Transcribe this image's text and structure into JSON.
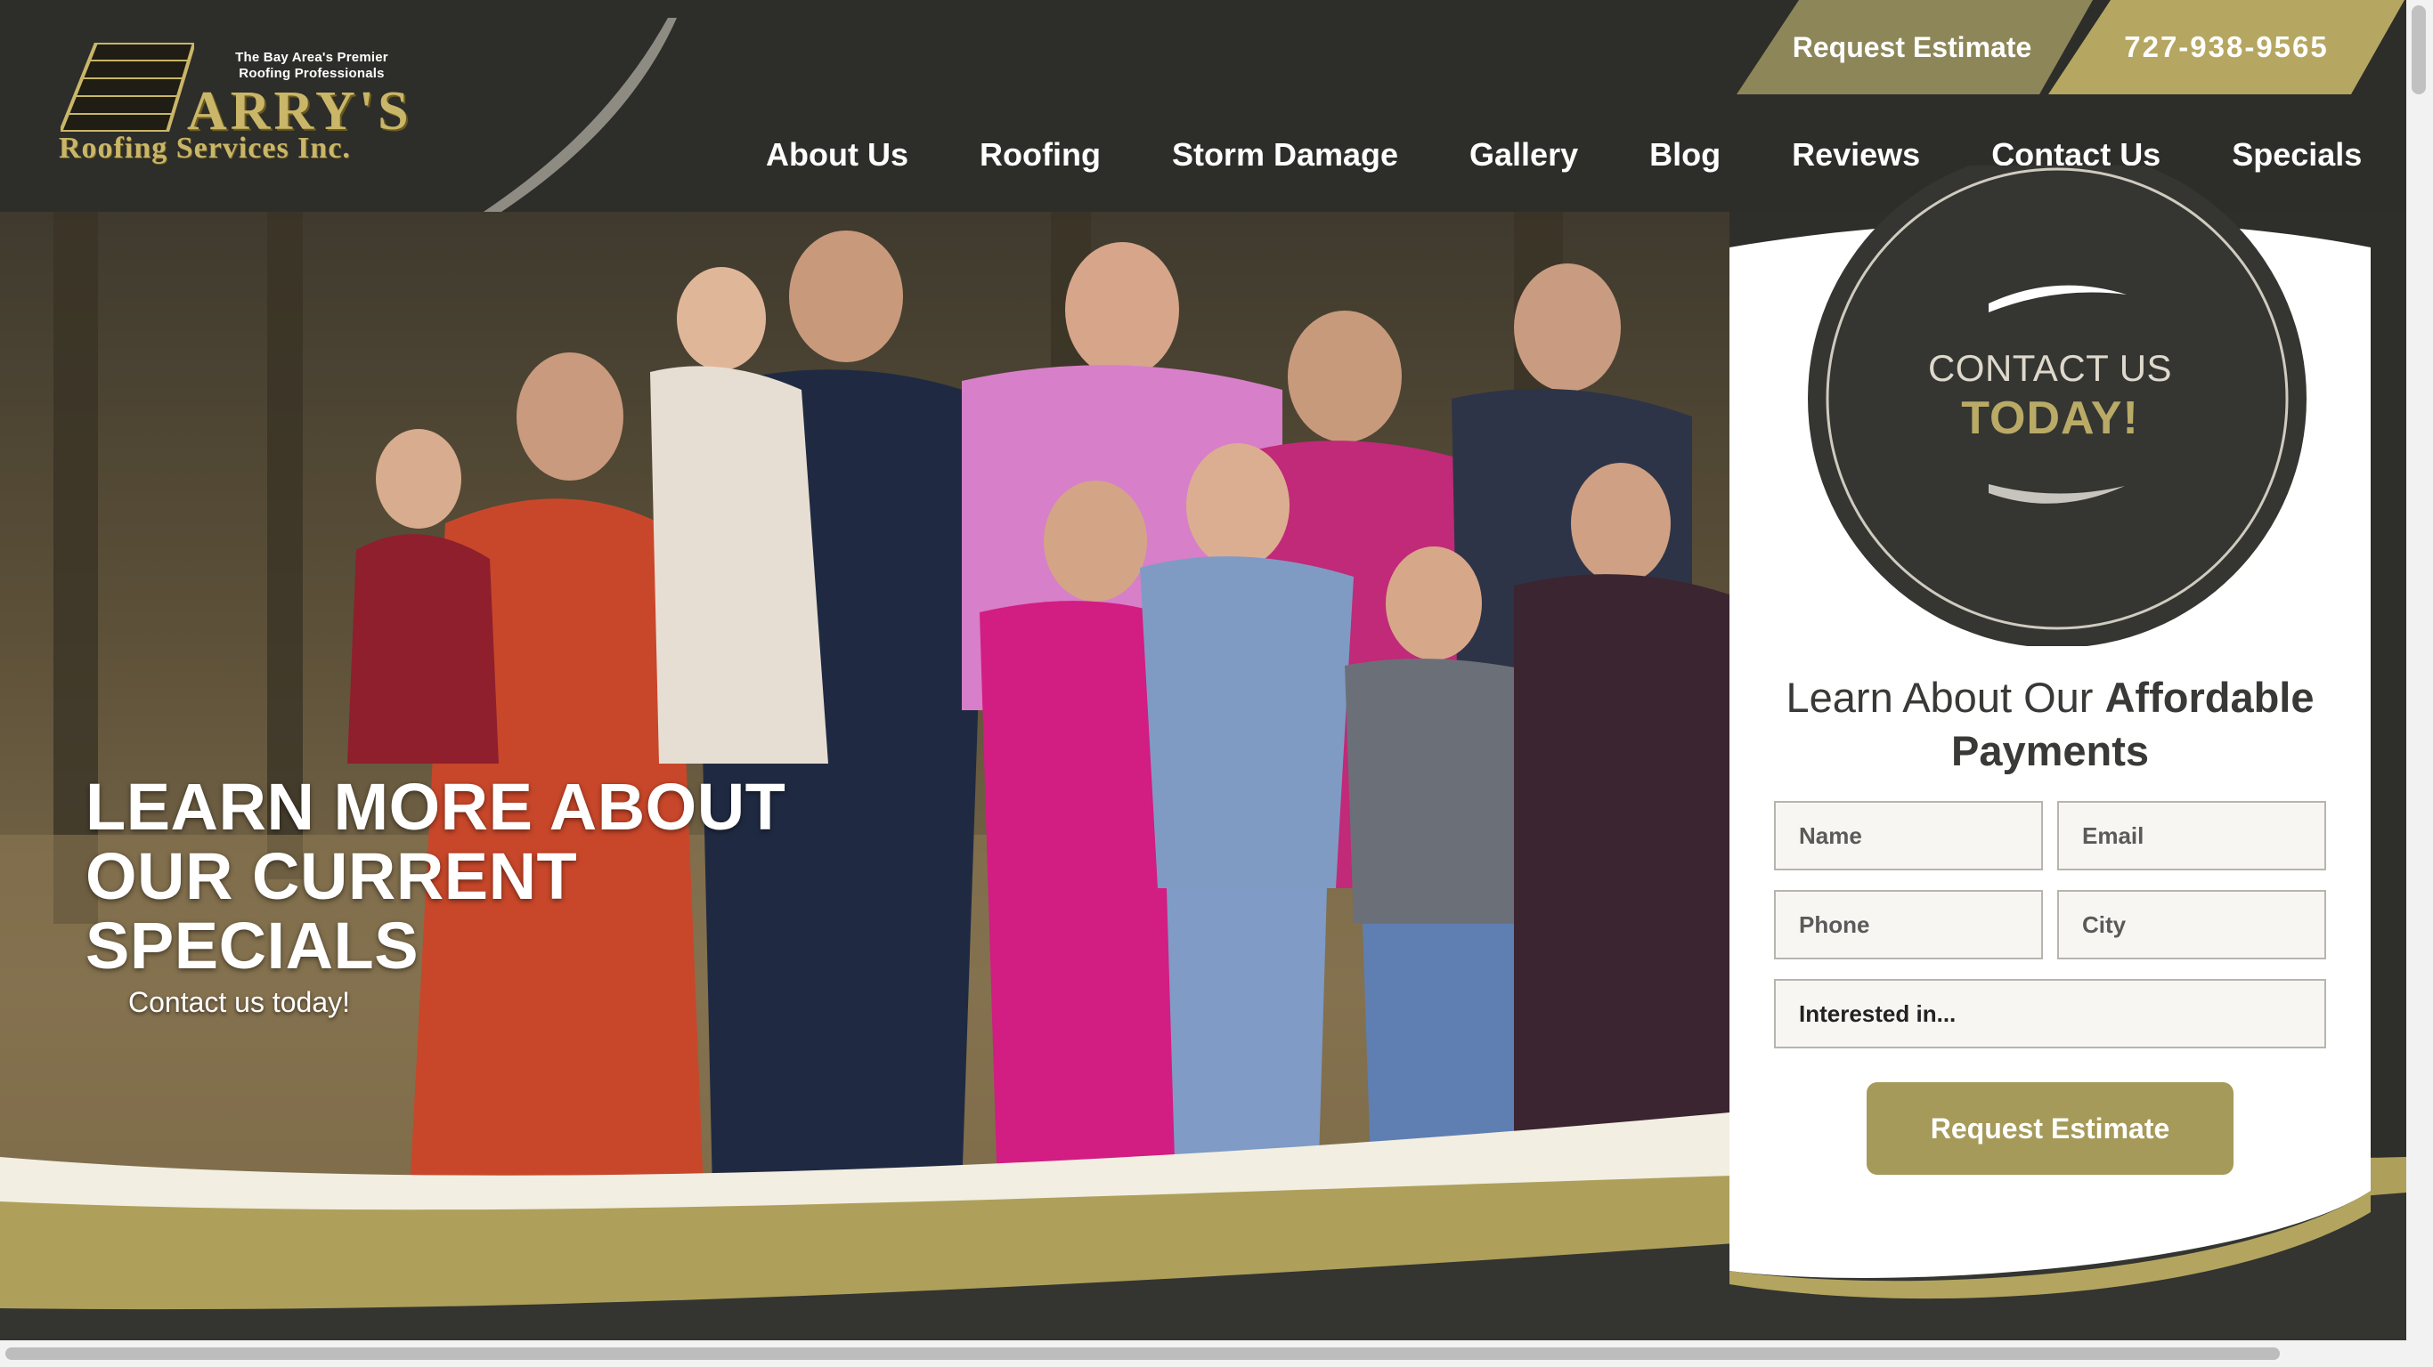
{
  "brand": {
    "tagline_line1": "The Bay Area's Premier",
    "tagline_line2": "Roofing Professionals",
    "logo_word": "ARRY'S",
    "logo_sub": "Roofing Services Inc.",
    "colors": {
      "gold": "#b5a661",
      "dark": "#2d2d2a",
      "olive": "#8d8658"
    }
  },
  "header": {
    "estimate_label": "Request Estimate",
    "phone": "727-938-9565",
    "nav": [
      "About Us",
      "Roofing",
      "Storm Damage",
      "Gallery",
      "Blog",
      "Reviews",
      "Contact Us",
      "Specials"
    ]
  },
  "hero": {
    "headline": "LEARN MORE ABOUT OUR CURRENT SPECIALS",
    "sub": "Contact us today!"
  },
  "form": {
    "badge_line1": "CONTACT US",
    "badge_line2": "TODAY!",
    "heading_plain": "Learn About Our ",
    "heading_bold": "Affordable Payments",
    "name_placeholder": "Name",
    "email_placeholder": "Email",
    "phone_placeholder": "Phone",
    "city_placeholder": "City",
    "interest_selected": "Interested in...",
    "submit_label": "Request Estimate"
  }
}
